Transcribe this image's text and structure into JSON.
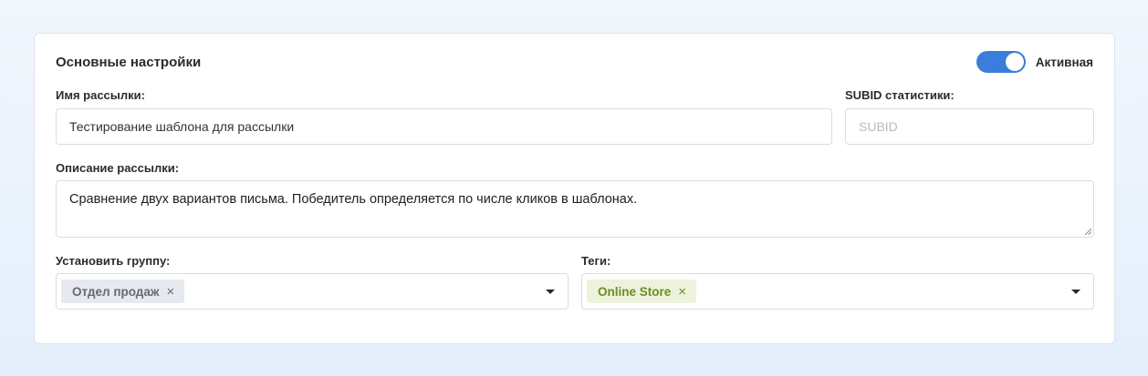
{
  "main_settings": {
    "title": "Основные настройки",
    "active_toggle": {
      "label": "Активная",
      "on": true
    }
  },
  "fields": {
    "mailing_name": {
      "label": "Имя рассылки:",
      "value": "Тестирование шаблона для рассылки"
    },
    "subid": {
      "label": "SUBID статистики:",
      "value": "",
      "placeholder": "SUBID"
    },
    "description": {
      "label": "Описание рассылки:",
      "value": "Сравнение двух вариантов письма. Победитель определяется по числе кликов в шаблонах."
    },
    "group": {
      "label": "Установить группу:",
      "chips": [
        "Отдел продаж"
      ]
    },
    "tags": {
      "label": "Теги:",
      "chips": [
        "Online Store"
      ]
    }
  },
  "icons": {
    "remove": "×",
    "dropdown": "caret-down-icon"
  },
  "colors": {
    "accent": "#3b7ddd",
    "tag_green": "#6b8e23",
    "chip_grey": "#656b73"
  }
}
